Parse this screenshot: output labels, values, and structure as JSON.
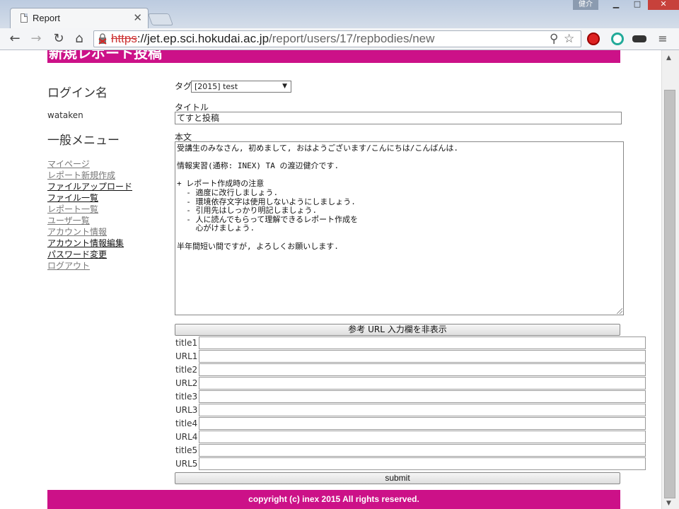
{
  "browser": {
    "tab_title": "Report",
    "tab_close": "✕",
    "user_label": "健介",
    "url_scheme": "https",
    "url_rest": "://jet.ep.sci.hokudai.ac.jp",
    "url_path": "/report/users/17/repbodies/new"
  },
  "page": {
    "header_title": "新規レポート投稿",
    "sidebar": {
      "login_heading": "ログイン名",
      "username": "wataken",
      "menu_heading": "一般メニュー",
      "menu_items": [
        "マイページ",
        "レポート新規作成",
        "ファイルアップロード",
        "ファイル一覧",
        "レポート一覧",
        "ユーザ一覧",
        "アカウント情報",
        "アカウント情報編集",
        "パスワード変更",
        "ログアウト"
      ]
    },
    "form": {
      "tag_label": "タグ",
      "tag_value": "[2015] test",
      "title_label": "タイトル",
      "title_value": "てすと投稿",
      "body_label": "本文",
      "body_value": "受講生のみなさん, 初めまして, おはようございます/こんにちは/こんばんは.\n\n情報実習(通称: INEX) TA の渡辺健介です.\n\n+ レポート作成時の注意\n  - 適度に改行しましょう.\n  - 環境依存文字は使用しないようにしましょう.\n  - 引用先はしっかり明記しましょう.\n  - 人に読んでもらって理解できるレポート作成を\n    心がけましょう.\n\n半年間短い間ですが, よろしくお願いします.",
      "toggle_label": "参考 URL 入力欄を非表示",
      "ref_labels": [
        "title1",
        "URL1",
        "title2",
        "URL2",
        "title3",
        "URL3",
        "title4",
        "URL4",
        "title5",
        "URL5"
      ],
      "submit_label": "submit"
    },
    "footer": "copyright (c) inex 2015 All rights reserved."
  }
}
